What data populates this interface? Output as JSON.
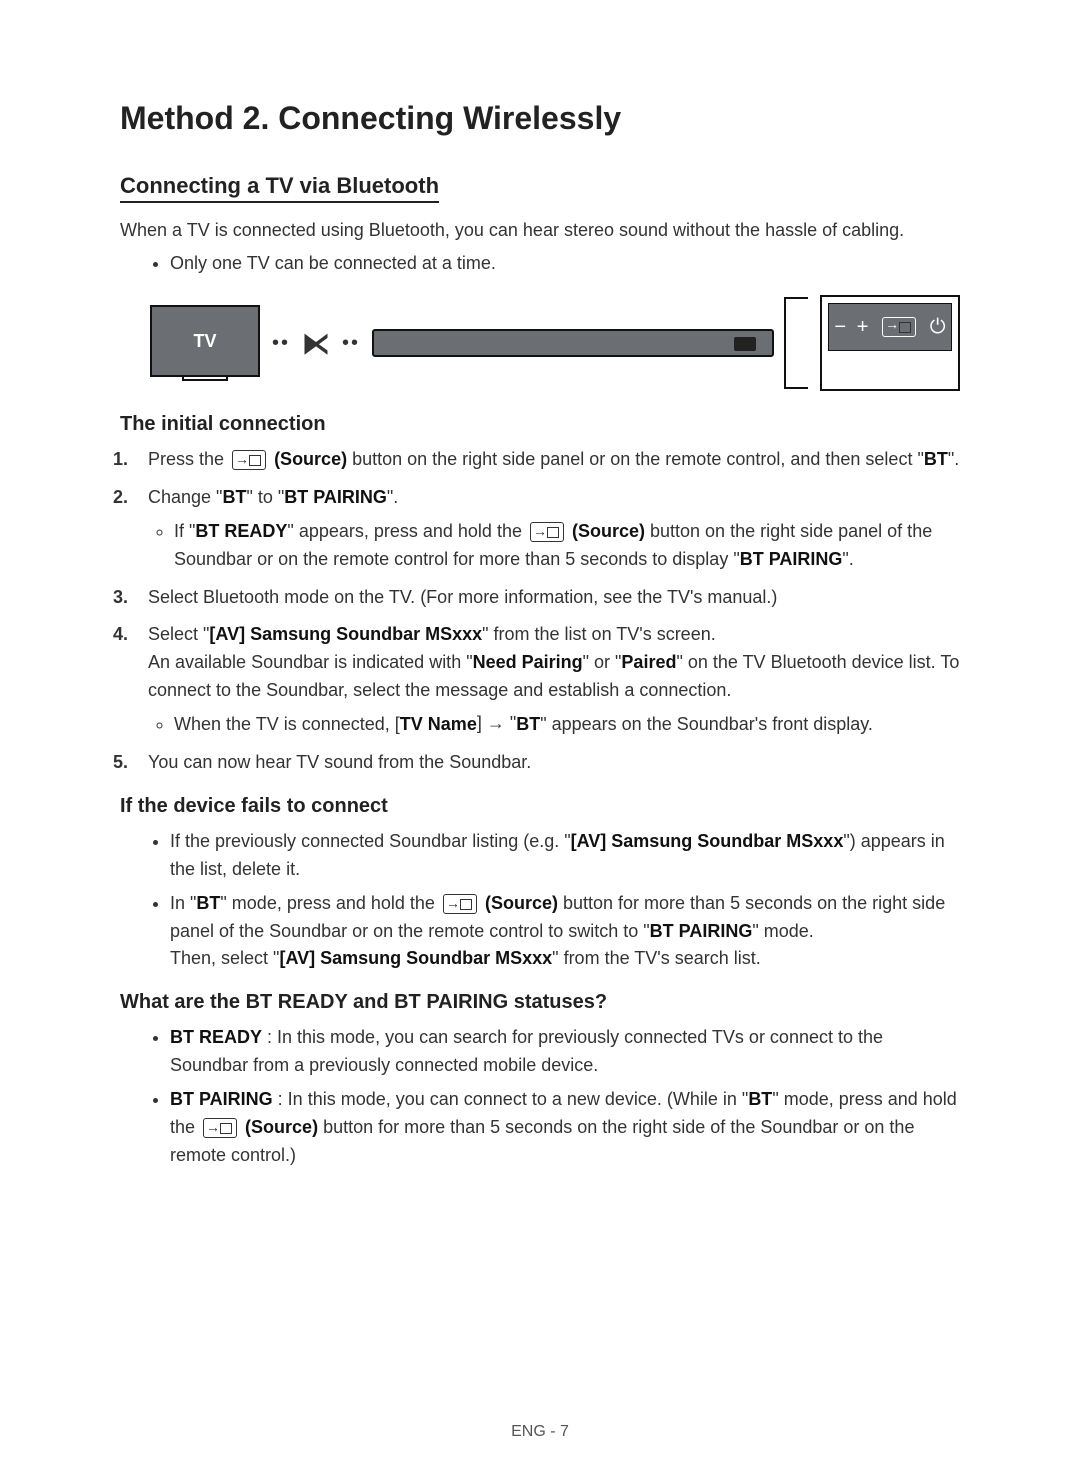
{
  "title": "Method 2. Connecting Wirelessly",
  "section1_title": "Connecting a TV via Bluetooth",
  "intro": "When a TV is connected using Bluetooth, you can hear stereo sound without the hassle of cabling.",
  "top_bullet": "Only one TV can be connected at a time.",
  "tv_label": "TV",
  "side_panel_minus": "−",
  "side_panel_plus": "+",
  "side_panel_power": "⏻",
  "initial_conn_title": "The initial connection",
  "source_label": "(Source)",
  "step1_pre": "Press the ",
  "step1_post": " button on the right side panel or on the remote control, and then select \"",
  "step1_bt": "BT",
  "step1_end": "\".",
  "step2_pre": "Change \"",
  "step2_bt": "BT",
  "step2_mid": "\" to \"",
  "step2_btp": "BT PAIRING",
  "step2_end": "\".",
  "step2_sub_pre": "If \"",
  "step2_sub_btr": "BT READY",
  "step2_sub_mid1": "\" appears, press and hold the ",
  "step2_sub_mid2": " button on the right side panel of the Soundbar or on the remote control for more than 5 seconds to display \"",
  "step2_sub_btp": "BT PAIRING",
  "step2_sub_end": "\".",
  "step3": "Select Bluetooth mode on the TV. (For more information, see the TV's manual.)",
  "step4_pre": "Select \"",
  "step4_dev": "[AV] Samsung Soundbar MSxxx",
  "step4_post": "\" from the list on TV's screen.",
  "step4_line2_pre": "An available Soundbar is indicated with \"",
  "step4_need": "Need Pairing",
  "step4_or": "\" or \"",
  "step4_paired": "Paired",
  "step4_line2_post": "\" on the TV Bluetooth device list. To connect to the Soundbar, select the message and establish a connection.",
  "step4_sub_pre": "When the TV is connected, [",
  "step4_tvname": "TV Name",
  "step4_arrow": "] → \"",
  "step4_bt": "BT",
  "step4_sub_post": "\" appears on the Soundbar's front display.",
  "step5": "You can now hear TV sound from the Soundbar.",
  "fail_title": "If the device fails to connect",
  "fail1_pre": "If the previously connected Soundbar listing (e.g. \"",
  "fail1_dev": "[AV] Samsung Soundbar MSxxx",
  "fail1_post": "\") appears in the list, delete it.",
  "fail2_pre": "In \"",
  "fail2_bt": "BT",
  "fail2_mid1": "\" mode, press and hold the ",
  "fail2_mid2": " button for more than 5 seconds on the right side panel of the Soundbar or on the remote control to switch to \"",
  "fail2_btp": "BT PAIRING",
  "fail2_mid3": "\" mode.",
  "fail2_then_pre": "Then, select \"",
  "fail2_dev": "[AV] Samsung Soundbar MSxxx",
  "fail2_then_post": "\" from the TV's search list.",
  "status_title": "What are the BT READY and BT PAIRING statuses?",
  "status1_label": "BT READY",
  "status1_text": " : In this mode, you can search for previously connected TVs or connect to the Soundbar from a previously connected mobile device.",
  "status2_label": "BT PAIRING",
  "status2_pre": " : In this mode, you can connect to a new device. (While in \"",
  "status2_bt": "BT",
  "status2_mid1": "\" mode, press and hold the ",
  "status2_mid2": " button for more than 5 seconds on the right side of the Soundbar or on the remote control.)",
  "footer": "ENG - 7"
}
